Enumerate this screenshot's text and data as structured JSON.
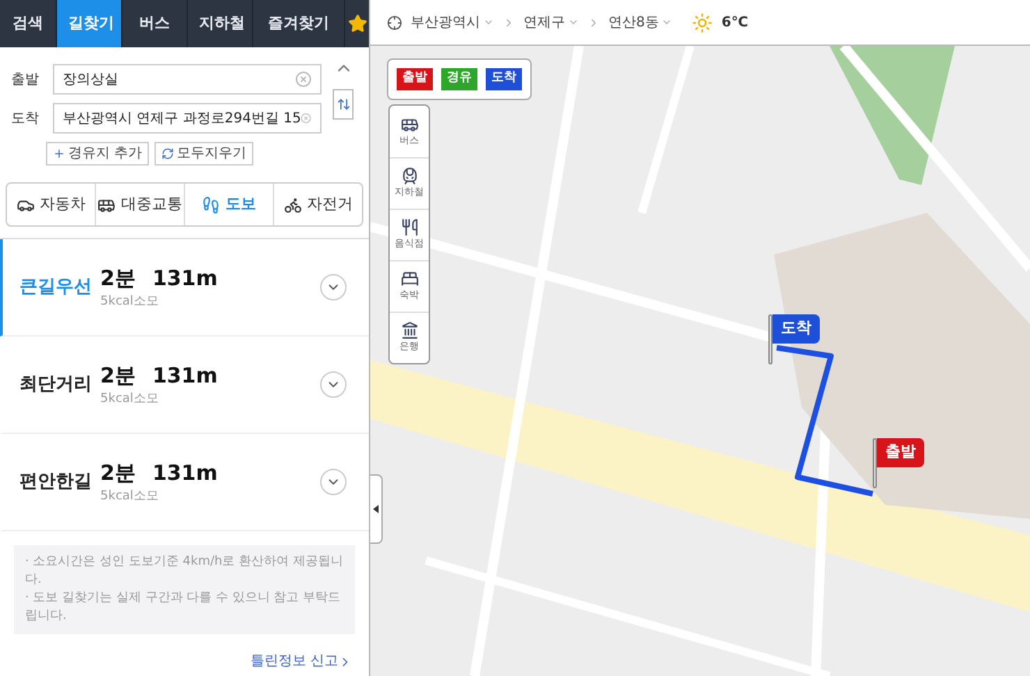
{
  "tabs": [
    {
      "label": "검색",
      "selected": false
    },
    {
      "label": "길찾기",
      "selected": true
    },
    {
      "label": "버스",
      "selected": false
    },
    {
      "label": "지하철",
      "selected": false
    },
    {
      "label": "즐겨찾기",
      "selected": false
    }
  ],
  "route_form": {
    "origin": {
      "label": "출발",
      "value": "장의상실"
    },
    "destination": {
      "label": "도착",
      "value": "부산광역시 연제구 과정로294번길 15"
    },
    "actions": [
      {
        "kind": "add",
        "label": "경유지 추가"
      },
      {
        "kind": "clear",
        "label": "모두지우기"
      }
    ]
  },
  "modes": [
    {
      "kind": "car",
      "label": "자동차",
      "selected": false
    },
    {
      "kind": "transit",
      "label": "대중교통",
      "selected": false
    },
    {
      "kind": "walk",
      "label": "도보",
      "selected": true
    },
    {
      "kind": "bike",
      "label": "자전거",
      "selected": false
    }
  ],
  "routes": [
    {
      "name": "큰길우선",
      "selected": true,
      "time": "2분",
      "distance": "131m",
      "calories": "5kcal소모"
    },
    {
      "name": "최단거리",
      "selected": false,
      "time": "2분",
      "distance": "131m",
      "calories": "5kcal소모"
    },
    {
      "name": "편안한길",
      "selected": false,
      "time": "2분",
      "distance": "131m",
      "calories": "5kcal소모"
    }
  ],
  "notices": [
    "· 소요시간은 성인 도보기준 4km/h로 환산하여 제공됩니다.",
    "· 도보 길찾기는 실제 구간과 다를 수 있으니 참고 부탁드립니다."
  ],
  "report_link": "틀린정보 신고",
  "location_bar": {
    "breadcrumb": [
      "부산광역시",
      "연제구",
      "연산8동"
    ],
    "temperature": "6℃"
  },
  "map": {
    "flag_buttons": [
      {
        "label": "출발",
        "color": "#d7141a"
      },
      {
        "label": "경유",
        "color": "#2ea52b"
      },
      {
        "label": "도착",
        "color": "#1e4fd8"
      }
    ],
    "layers": [
      {
        "kind": "bus",
        "label": "버스"
      },
      {
        "kind": "subway",
        "label": "지하철"
      },
      {
        "kind": "food",
        "label": "음식점"
      },
      {
        "kind": "hotel",
        "label": "숙박"
      },
      {
        "kind": "bank",
        "label": "은행"
      }
    ],
    "markers": [
      {
        "kind": "end",
        "label": "도착",
        "color": "#1e4fd8"
      },
      {
        "kind": "start",
        "label": "출발",
        "color": "#d7141a"
      }
    ]
  }
}
